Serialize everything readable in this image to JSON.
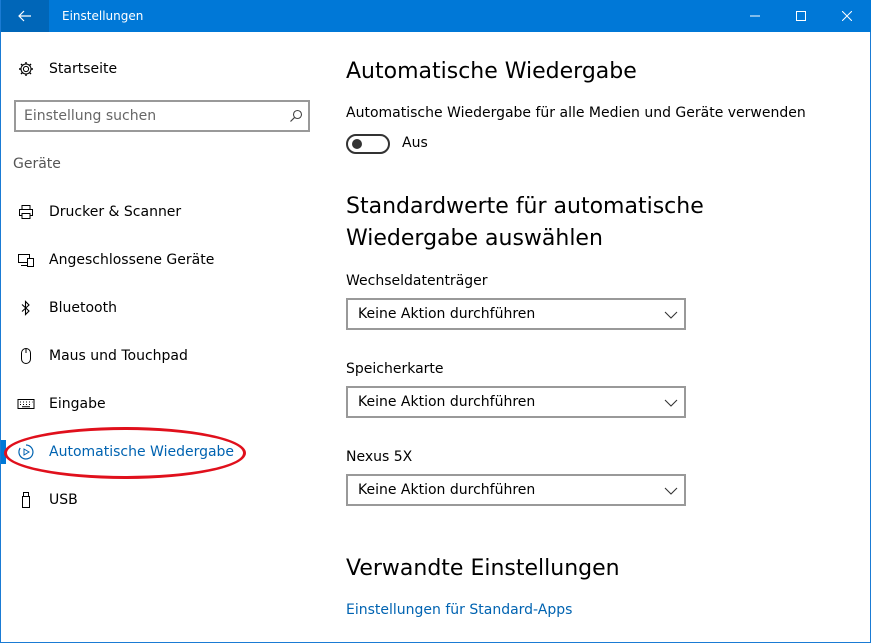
{
  "window": {
    "title": "Einstellungen"
  },
  "sidebar": {
    "home_label": "Startseite",
    "search_placeholder": "Einstellung suchen",
    "section_title": "Geräte",
    "items": [
      {
        "label": "Drucker & Scanner",
        "icon": "printer-icon"
      },
      {
        "label": "Angeschlossene Geräte",
        "icon": "devices-icon"
      },
      {
        "label": "Bluetooth",
        "icon": "bluetooth-icon"
      },
      {
        "label": "Maus und Touchpad",
        "icon": "mouse-icon"
      },
      {
        "label": "Eingabe",
        "icon": "keyboard-icon"
      },
      {
        "label": "Automatische Wiedergabe",
        "icon": "autoplay-icon",
        "active": true
      },
      {
        "label": "USB",
        "icon": "usb-icon"
      }
    ]
  },
  "content": {
    "title": "Automatische Wiedergabe",
    "toggle_description": "Automatische Wiedergabe für alle Medien und Geräte verwenden",
    "toggle_state": "Aus",
    "defaults_title_line1": "Standardwerte für automatische",
    "defaults_title_line2": "Wiedergabe auswählen",
    "dropdowns": [
      {
        "label": "Wechseldatenträger",
        "value": "Keine Aktion durchführen"
      },
      {
        "label": "Speicherkarte",
        "value": "Keine Aktion durchführen"
      },
      {
        "label": "Nexus 5X",
        "value": "Keine Aktion durchführen"
      }
    ],
    "related_title": "Verwandte Einstellungen",
    "related_link": "Einstellungen für Standard-Apps"
  },
  "colors": {
    "accent": "#0078d7",
    "annotation": "#e0101c"
  }
}
